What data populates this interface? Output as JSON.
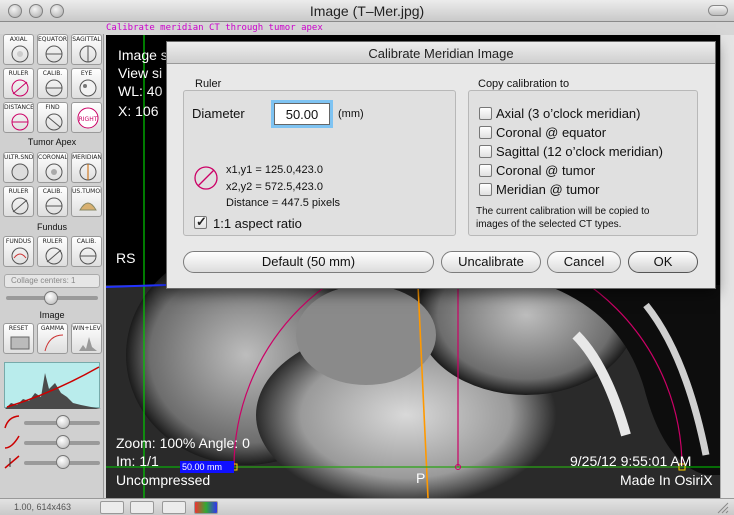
{
  "window": {
    "title": "Image (T–Mer.jpg)"
  },
  "caption": "Calibrate meridian CT through tumor apex",
  "palette": {
    "row1": [
      "AXIAL",
      "EQUATOR",
      "SAGITTAL"
    ],
    "row2": [
      "RULER",
      "CALIB.",
      "EYE"
    ],
    "row3": [
      "DISTANCE",
      "FIND",
      "RIGHT"
    ],
    "section_tumor_apex": "Tumor Apex",
    "row4": [
      "ULTR.SND",
      "CORONAL",
      "MERIDIAN"
    ],
    "row5": [
      "RULER",
      "CALIB.",
      "US.TUMOR"
    ],
    "section_fundus": "Fundus",
    "row6": [
      "FUNDUS",
      "RULER",
      "CALIB."
    ],
    "collage_placeholder": "Collage centers: 1",
    "section_image": "Image",
    "row7": [
      "RESET",
      "GAMMA",
      "WIN+LEV"
    ]
  },
  "status_bar": {
    "text": "1.00, 614x463"
  },
  "viewer": {
    "overlay_image": "Image s",
    "overlay_view": "View si",
    "overlay_wl": "WL: 40",
    "overlay_x": "X: 106",
    "overlay_rs": "RS",
    "overlay_zoom": "Zoom: 100% Angle: 0",
    "overlay_im": "Im: 1/1",
    "overlay_measure": "50.00 mm",
    "overlay_compression": "Uncompressed",
    "overlay_p": "P",
    "overlay_date": "9/25/12 9:55:01 AM",
    "overlay_made": "Made In OsiriX"
  },
  "dialog": {
    "title": "Calibrate Meridian Image",
    "ruler_group": "Ruler",
    "diameter_label": "Diameter",
    "diameter_value": "50.00",
    "diameter_unit": "(mm)",
    "coords1": "x1,y1 = 125.0,423.0",
    "coords2": "x2,y2 = 572.5,423.0",
    "distance": "Distance = 447.5 pixels",
    "aspect_label": "1:1 aspect ratio",
    "aspect_checked": true,
    "copy_group": "Copy calibration to",
    "copy_options": [
      {
        "label": "Axial (3 o’clock meridian)",
        "checked": false
      },
      {
        "label": "Coronal @ equator",
        "checked": false
      },
      {
        "label": "Sagittal (12 o’clock meridian)",
        "checked": false
      },
      {
        "label": "Coronal @ tumor",
        "checked": false
      },
      {
        "label": "Meridian @ tumor",
        "checked": false
      }
    ],
    "copy_note_1": "The current calibration will be copied to",
    "copy_note_2": "images of the selected CT types.",
    "buttons": {
      "default": "Default (50 mm)",
      "uncalibrate": "Uncalibrate",
      "cancel": "Cancel",
      "ok": "OK"
    }
  },
  "colors": {
    "focus_ring": "#7ec3f2",
    "overlay_green": "#00cc00",
    "overlay_magenta": "#cc0066",
    "overlay_orange": "#ff9900",
    "measure_blue": "#1010ff",
    "histogram_bg": "#b9ecec"
  }
}
